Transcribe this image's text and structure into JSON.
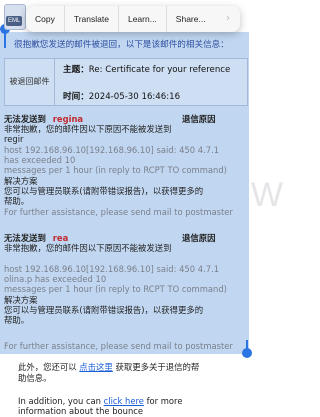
{
  "context_menu": {
    "items": [
      "Copy",
      "Translate",
      "Learn...",
      "Share..."
    ],
    "arrow": "›"
  },
  "file_icon": {
    "label": "EML"
  },
  "header_text": "很抱歉您发送的邮件被退回，以下是该邮件的相关信息：",
  "info_box": {
    "label": "被退回邮件",
    "subject_key": "主题：",
    "subject_value": "Re: Certificate for your reference",
    "time_key": "时间：",
    "time_value": "2024-05-30 16:46:16"
  },
  "block1": {
    "line1_prefix": "无法发送到",
    "line1_name": "regina",
    "line1_suffix": "退信原因",
    "line2": "非常抱歉，您的邮件因以下原因不能被发送到",
    "line3": "regir",
    "line4": "host 192.168.96.10[192.168.96.10] said: 450 4.7.1",
    "line5": "                                  has exceeded 10",
    "line6": "messages per 1 hour (in reply to RCPT TO command)",
    "line7": "解决方案",
    "line8": "您可以与管理员联系(请附带错误报告)，以获得更多的",
    "line9": "帮助。",
    "line10": "For further assistance, please send mail to postmaster"
  },
  "block2": {
    "line1_prefix": "无法发送到",
    "line1_name": "rea",
    "line1_suffix": "退信原因",
    "line2": "非常抱歉，您的邮件因以下原因不能被发送到",
    "line3": "",
    "line4": "host 192.168.96.10[192.168.96.10] said: 450 4.7.1",
    "line5": "olina.p                           has exceeded 10",
    "line6": "messages per 1 hour (in reply to RCPT TO command)",
    "line7": "解决方案",
    "line8": "您可以与管理员联系(请附带错误报告)，以获得更多的",
    "line9": "帮助。",
    "line10": "For further assistance, please send mail to postmaster"
  },
  "footer": {
    "cn_prefix": "此外，您还可以",
    "cn_link": "点击这里",
    "cn_suffix": "获取更多关于退信的帮",
    "cn_line2": "助信息。",
    "en_prefix": "In addition, you can",
    "en_link": "click here",
    "en_suffix": "for more",
    "en_line2": "information about the bounce"
  },
  "watermark": "W"
}
